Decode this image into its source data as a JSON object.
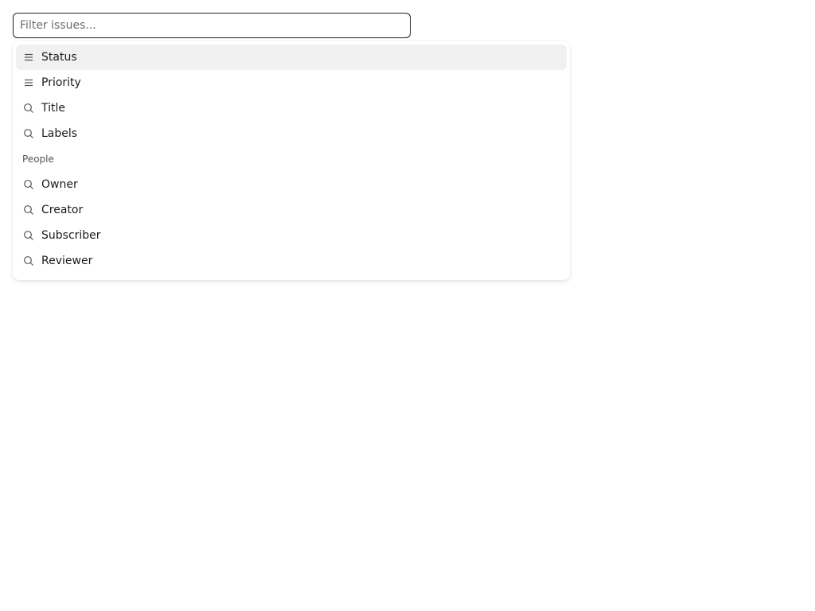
{
  "filter": {
    "placeholder": "Filter issues...",
    "value": ""
  },
  "menu": {
    "items": [
      {
        "label": "Status",
        "icon": "lines-icon",
        "active": true
      },
      {
        "label": "Priority",
        "icon": "lines-icon",
        "active": false
      },
      {
        "label": "Title",
        "icon": "search-icon",
        "active": false
      },
      {
        "label": "Labels",
        "icon": "search-icon",
        "active": false
      }
    ],
    "group_label": "People",
    "people_items": [
      {
        "label": "Owner",
        "icon": "search-icon"
      },
      {
        "label": "Creator",
        "icon": "search-icon"
      },
      {
        "label": "Subscriber",
        "icon": "search-icon"
      },
      {
        "label": "Reviewer",
        "icon": "search-icon"
      }
    ]
  },
  "colors": {
    "active_bg": "#f1f1f1",
    "icon": "#555555"
  }
}
